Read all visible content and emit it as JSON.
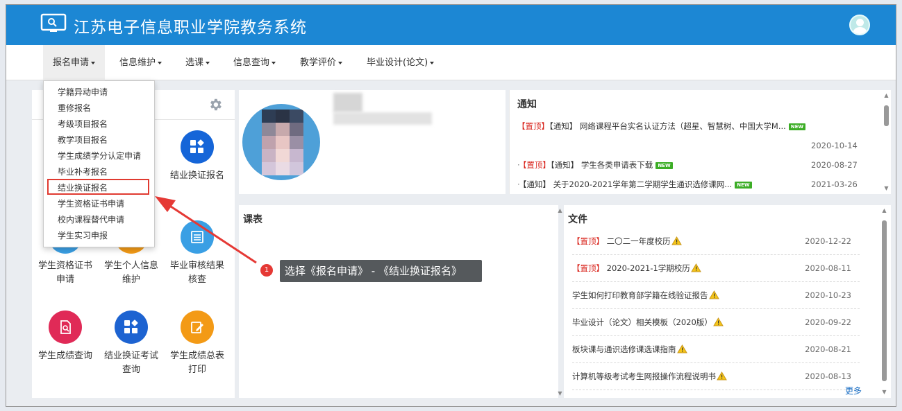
{
  "app": {
    "title": "江苏电子信息职业学院教务系统"
  },
  "nav": {
    "items": [
      {
        "label": "报名申请"
      },
      {
        "label": "信息维护"
      },
      {
        "label": "选课"
      },
      {
        "label": "信息查询"
      },
      {
        "label": "教学评价"
      },
      {
        "label": "毕业设计(论文)"
      }
    ]
  },
  "dropdown": {
    "items": [
      "学籍异动申请",
      "重修报名",
      "考级项目报名",
      "教学项目报名",
      "学生成绩学分认定申请",
      "毕业补考报名",
      "结业换证报名",
      "学生资格证书申请",
      "校内课程替代申请",
      "学生实习申报"
    ],
    "highlighted_index": 6
  },
  "tiles": {
    "t1": {
      "label": "结业换证报名",
      "icon": "grid-icon"
    },
    "t2": {
      "label": "学生资格证书申请",
      "icon": "book-icon"
    },
    "t3": {
      "label": "学生个人信息维护",
      "icon": "user-icon"
    },
    "t4": {
      "label": "毕业审核结果核查",
      "icon": "list-icon"
    },
    "t5": {
      "label": "学生成绩查询",
      "icon": "document-icon"
    },
    "t6": {
      "label": "结业换证考试查询",
      "icon": "grid-icon"
    },
    "t7": {
      "label": "学生成绩总表打印",
      "icon": "edit-icon"
    }
  },
  "notice": {
    "title": "通知",
    "rows": [
      {
        "tag1": "【置顶】",
        "tag2": "【通知】",
        "text": "网络课程平台实名认证方法（超星、智慧树、中国大学M...",
        "new": "NEW",
        "date": "2020-10-14"
      },
      {
        "tag1": "【置顶】",
        "tag2": "【通知】",
        "text": "学生各类申请表下载",
        "new": "NEW",
        "date": "2020-08-27"
      },
      {
        "tag1": "",
        "tag2": "【通知】",
        "text": "关于2020-2021学年第二学期学生通识选修课网...",
        "new": "NEW",
        "date": "2021-03-26"
      }
    ]
  },
  "schedule": {
    "title": "课表"
  },
  "files": {
    "title": "文件",
    "rows": [
      {
        "tag": "【置顶】",
        "name": "二〇二一年度校历",
        "date": "2020-12-22"
      },
      {
        "tag": "【置顶】",
        "name": "2020-2021-1学期校历",
        "date": "2020-08-11"
      },
      {
        "tag": "",
        "name": "学生如何打印教育部学籍在线验证报告",
        "date": "2020-10-23"
      },
      {
        "tag": "",
        "name": "毕业设计（论文）相关模板（2020版）",
        "date": "2020-09-22"
      },
      {
        "tag": "",
        "name": "板块课与通识选修课选课指南",
        "date": "2020-08-21"
      },
      {
        "tag": "",
        "name": "计算机等级考试考生网报操作流程说明书",
        "date": "2020-08-13"
      }
    ],
    "more": "更多"
  },
  "annotation": {
    "step": "1",
    "text": "选择《报名申请》 - 《结业换证报名》"
  },
  "colors": {
    "header": "#1c87d4",
    "highlight_box": "#e03a30",
    "arrow": "#e53935",
    "callout_bg": "#55595c"
  }
}
